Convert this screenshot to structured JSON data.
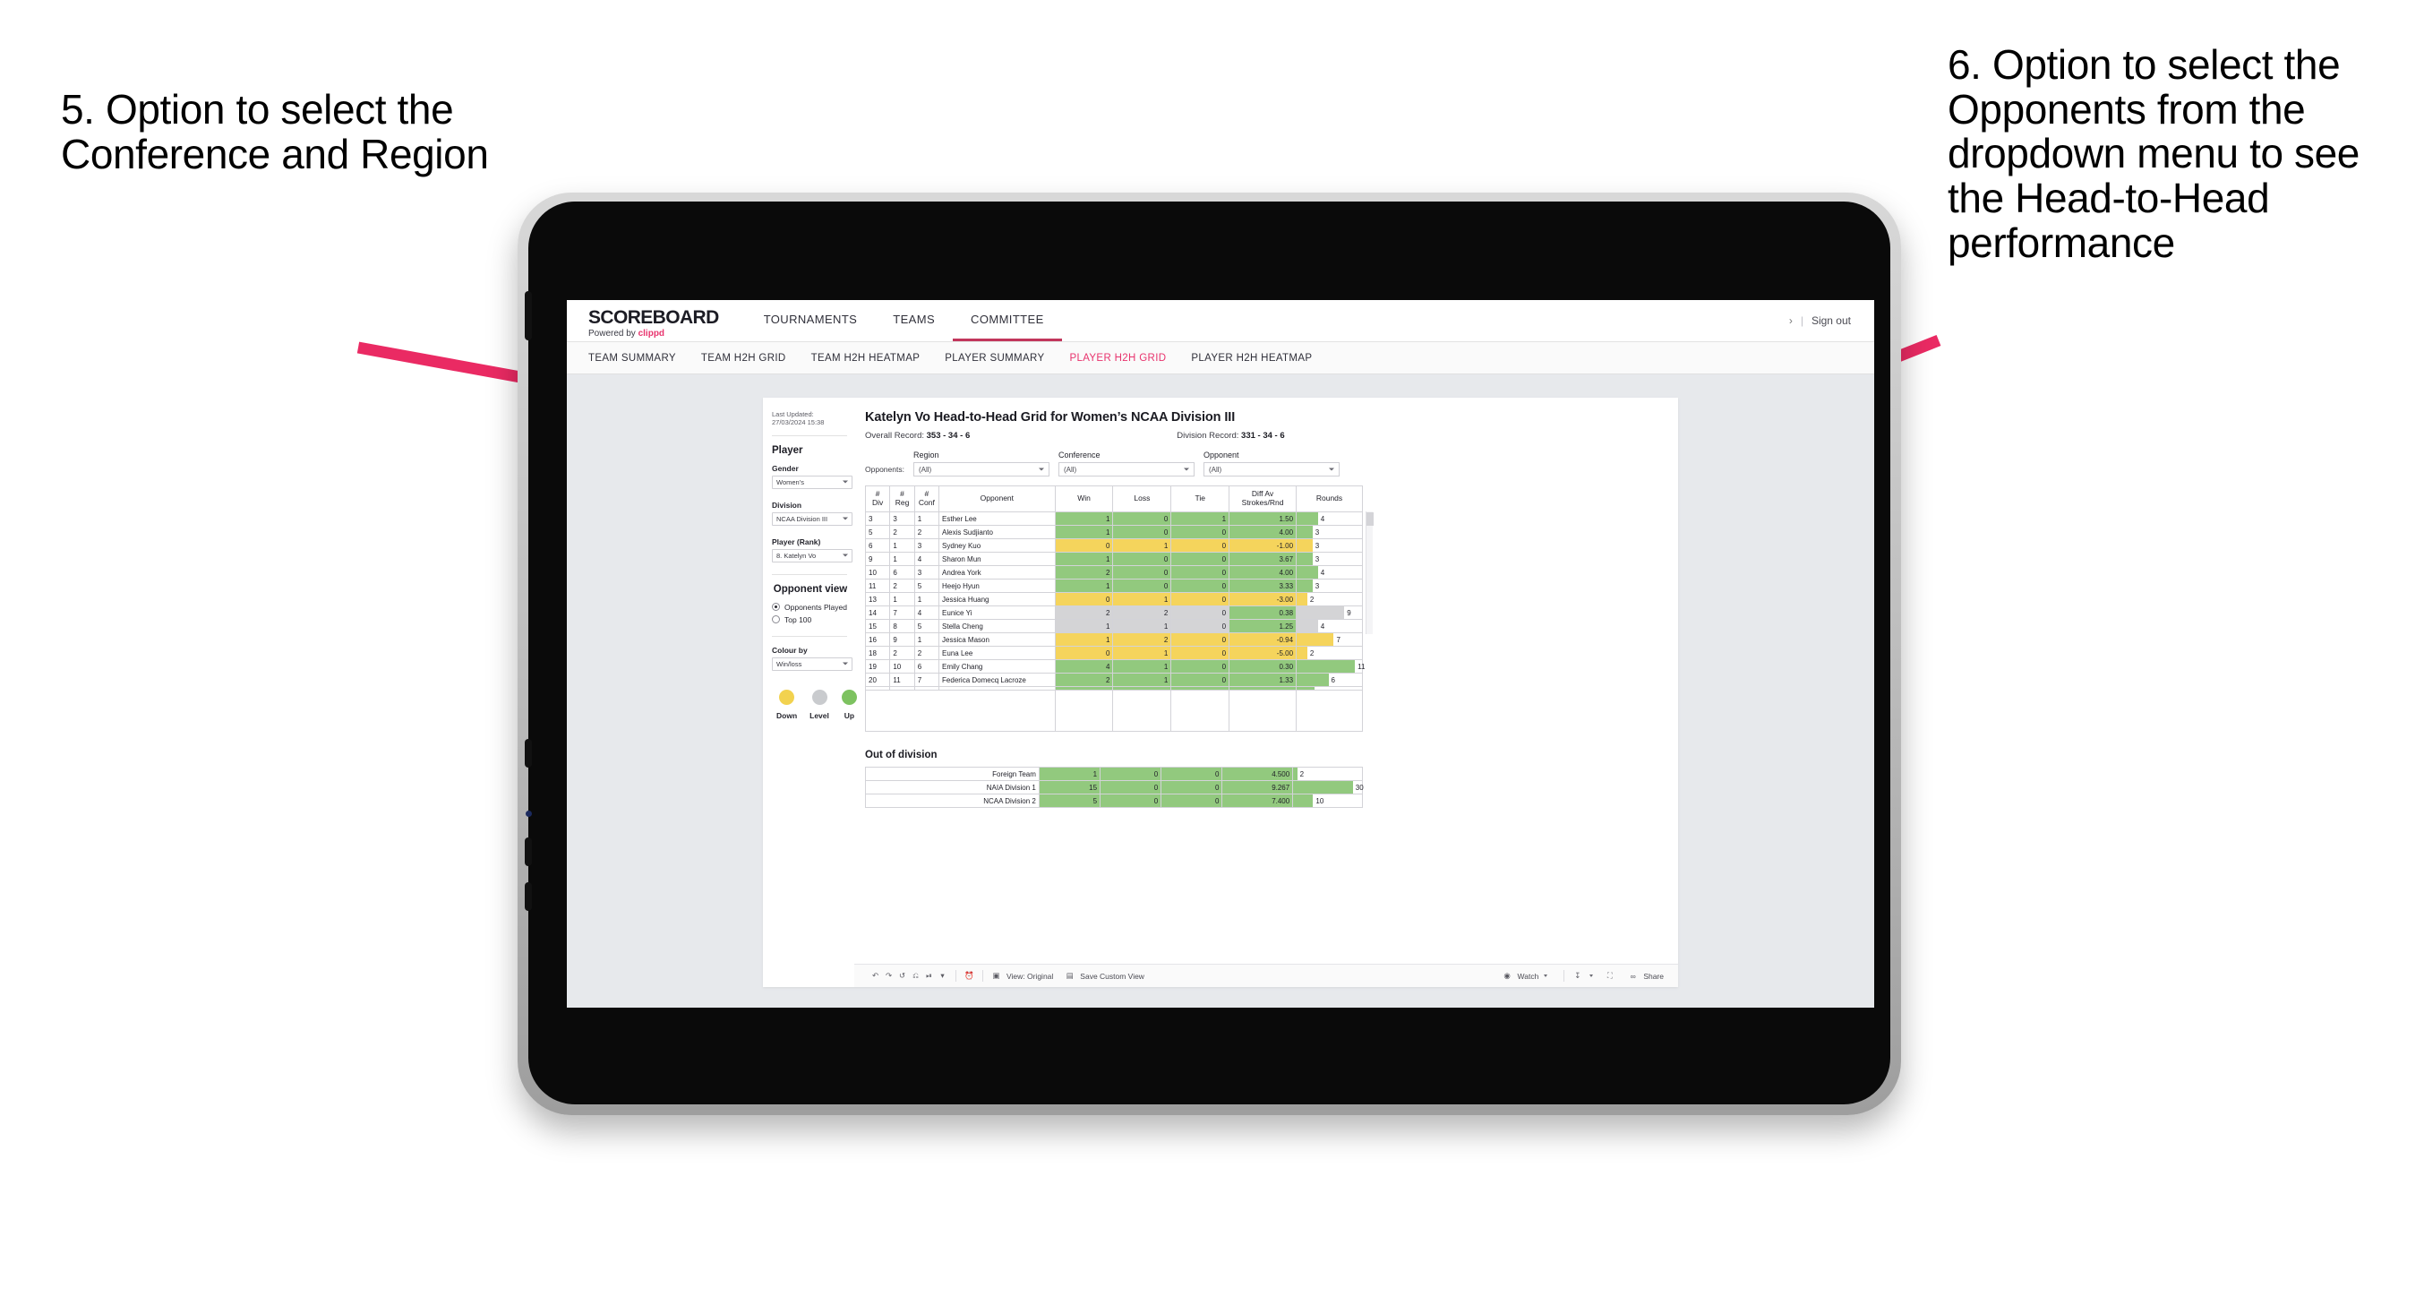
{
  "annotations": {
    "left": "5. Option to select the Conference and Region",
    "right": "6. Option to select the Opponents from the dropdown menu to see the Head-to-Head performance",
    "arrow_color": "#ea2a63"
  },
  "header": {
    "logo_main": "SCOREBOARD",
    "logo_sub_prefix": "Powered by",
    "logo_sub_brand": "clippd",
    "nav": [
      {
        "label": "TOURNAMENTS",
        "active": false
      },
      {
        "label": "TEAMS",
        "active": false
      },
      {
        "label": "COMMITTEE",
        "active": true
      }
    ],
    "chevron": "›",
    "separator": "|",
    "sign_out": "Sign out"
  },
  "subnav": {
    "items": [
      {
        "label": "TEAM SUMMARY",
        "active": false
      },
      {
        "label": "TEAM H2H GRID",
        "active": false
      },
      {
        "label": "TEAM H2H HEATMAP",
        "active": false
      },
      {
        "label": "PLAYER SUMMARY",
        "active": false
      },
      {
        "label": "PLAYER H2H GRID",
        "active": true
      },
      {
        "label": "PLAYER H2H HEATMAP",
        "active": false
      }
    ],
    "active_color": "#e8336d"
  },
  "sidebar": {
    "last_updated": "Last Updated: 27/03/2024 15:38",
    "player_heading": "Player",
    "fields": [
      {
        "label": "Gender",
        "value": "Women’s"
      },
      {
        "label": "Division",
        "value": "NCAA Division III"
      },
      {
        "label": "Player (Rank)",
        "value": "8. Katelyn Vo"
      }
    ],
    "opponent_view": {
      "heading": "Opponent view",
      "options": [
        {
          "label": "Opponents Played",
          "selected": true
        },
        {
          "label": "Top 100",
          "selected": false
        }
      ]
    },
    "colour_by": {
      "label": "Colour by",
      "value": "Win/loss"
    },
    "legend": [
      {
        "label": "Down",
        "color": "#f2d24f"
      },
      {
        "label": "Level",
        "color": "#c9cbce"
      },
      {
        "label": "Up",
        "color": "#7dc260"
      }
    ]
  },
  "main": {
    "title": "Katelyn Vo Head-to-Head Grid for Women’s NCAA Division III",
    "overall_record_label": "Overall Record:",
    "overall_record_value": "353 - 34 - 6",
    "division_record_label": "Division Record:",
    "division_record_value": "331 - 34 - 6",
    "filters_label": "Opponents:",
    "filters": [
      {
        "label": "Region",
        "value": "(All)"
      },
      {
        "label": "Conference",
        "value": "(All)"
      },
      {
        "label": "Opponent",
        "value": "(All)"
      }
    ]
  },
  "chart_data": {
    "type": "table",
    "title": "Katelyn Vo Head-to-Head Grid for Women’s NCAA Division III",
    "columns": [
      "# Div",
      "# Reg",
      "# Conf",
      "Opponent",
      "Win",
      "Loss",
      "Tie",
      "Diff Av Strokes/Rnd",
      "Rounds"
    ],
    "column_headers_multiline": [
      [
        "#",
        "Div"
      ],
      [
        "#",
        "Reg"
      ],
      [
        "#",
        "Conf"
      ],
      [
        "Opponent"
      ],
      [
        "Win"
      ],
      [
        "Loss"
      ],
      [
        "Tie"
      ],
      [
        "Diff Av",
        "Strokes/Rnd"
      ],
      [
        "Rounds"
      ]
    ],
    "rounds_max": 12,
    "colors": {
      "up": "#92c97e",
      "down": "#f5d45c",
      "level": "#d4d4d6",
      "none": "#ffffff"
    },
    "rows": [
      {
        "div": "3",
        "reg": "3",
        "conf": "1",
        "opponent": "Esther Lee",
        "win": "1",
        "loss": "0",
        "tie": "1",
        "diff": "1.50",
        "rounds": 4,
        "state": "up"
      },
      {
        "div": "5",
        "reg": "2",
        "conf": "2",
        "opponent": "Alexis Sudjianto",
        "win": "1",
        "loss": "0",
        "tie": "0",
        "diff": "4.00",
        "rounds": 3,
        "state": "up"
      },
      {
        "div": "6",
        "reg": "1",
        "conf": "3",
        "opponent": "Sydney Kuo",
        "win": "0",
        "loss": "1",
        "tie": "0",
        "diff": "-1.00",
        "rounds": 3,
        "state": "down"
      },
      {
        "div": "9",
        "reg": "1",
        "conf": "4",
        "opponent": "Sharon Mun",
        "win": "1",
        "loss": "0",
        "tie": "0",
        "diff": "3.67",
        "rounds": 3,
        "state": "up"
      },
      {
        "div": "10",
        "reg": "6",
        "conf": "3",
        "opponent": "Andrea York",
        "win": "2",
        "loss": "0",
        "tie": "0",
        "diff": "4.00",
        "rounds": 4,
        "state": "up"
      },
      {
        "div": "11",
        "reg": "2",
        "conf": "5",
        "opponent": "Heejo Hyun",
        "win": "1",
        "loss": "0",
        "tie": "0",
        "diff": "3.33",
        "rounds": 3,
        "state": "up"
      },
      {
        "div": "13",
        "reg": "1",
        "conf": "1",
        "opponent": "Jessica Huang",
        "win": "0",
        "loss": "1",
        "tie": "0",
        "diff": "-3.00",
        "rounds": 2,
        "state": "down"
      },
      {
        "div": "14",
        "reg": "7",
        "conf": "4",
        "opponent": "Eunice Yi",
        "win": "2",
        "loss": "2",
        "tie": "0",
        "diff": "0.38",
        "rounds": 9,
        "state": "level",
        "diff_state": "up"
      },
      {
        "div": "15",
        "reg": "8",
        "conf": "5",
        "opponent": "Stella Cheng",
        "win": "1",
        "loss": "1",
        "tie": "0",
        "diff": "1.25",
        "rounds": 4,
        "state": "level",
        "diff_state": "up"
      },
      {
        "div": "16",
        "reg": "9",
        "conf": "1",
        "opponent": "Jessica Mason",
        "win": "1",
        "loss": "2",
        "tie": "0",
        "diff": "-0.94",
        "rounds": 7,
        "state": "down"
      },
      {
        "div": "18",
        "reg": "2",
        "conf": "2",
        "opponent": "Euna Lee",
        "win": "0",
        "loss": "1",
        "tie": "0",
        "diff": "-5.00",
        "rounds": 2,
        "state": "down"
      },
      {
        "div": "19",
        "reg": "10",
        "conf": "6",
        "opponent": "Emily Chang",
        "win": "4",
        "loss": "1",
        "tie": "0",
        "diff": "0.30",
        "rounds": 11,
        "state": "up"
      },
      {
        "div": "20",
        "reg": "11",
        "conf": "7",
        "opponent": "Federica Domecq Lacroze",
        "win": "2",
        "loss": "1",
        "tie": "0",
        "diff": "1.33",
        "rounds": 6,
        "state": "up"
      }
    ],
    "out_of_division": {
      "title": "Out of division",
      "rounds_max": 32,
      "rows": [
        {
          "name": "Foreign Team",
          "win": "1",
          "loss": "0",
          "tie": "0",
          "diff": "4.500",
          "rounds": 2,
          "state": "up"
        },
        {
          "name": "NAIA Division 1",
          "win": "15",
          "loss": "0",
          "tie": "0",
          "diff": "9.267",
          "rounds": 30,
          "state": "up"
        },
        {
          "name": "NCAA Division 2",
          "win": "5",
          "loss": "0",
          "tie": "0",
          "diff": "7.400",
          "rounds": 10,
          "state": "up"
        }
      ]
    }
  },
  "toolbar": {
    "icons": [
      "undo-icon",
      "redo-icon",
      "revert-icon",
      "refresh-icon",
      "pause-icon",
      "dropdown-arrow-icon"
    ],
    "alert_icon": "alert-icon",
    "view_label": "View: Original",
    "save_label": "Save Custom View",
    "watch_label": "Watch",
    "download_icon": "download-icon",
    "fullscreen_icon": "fullscreen-icon",
    "share_label": "Share"
  }
}
